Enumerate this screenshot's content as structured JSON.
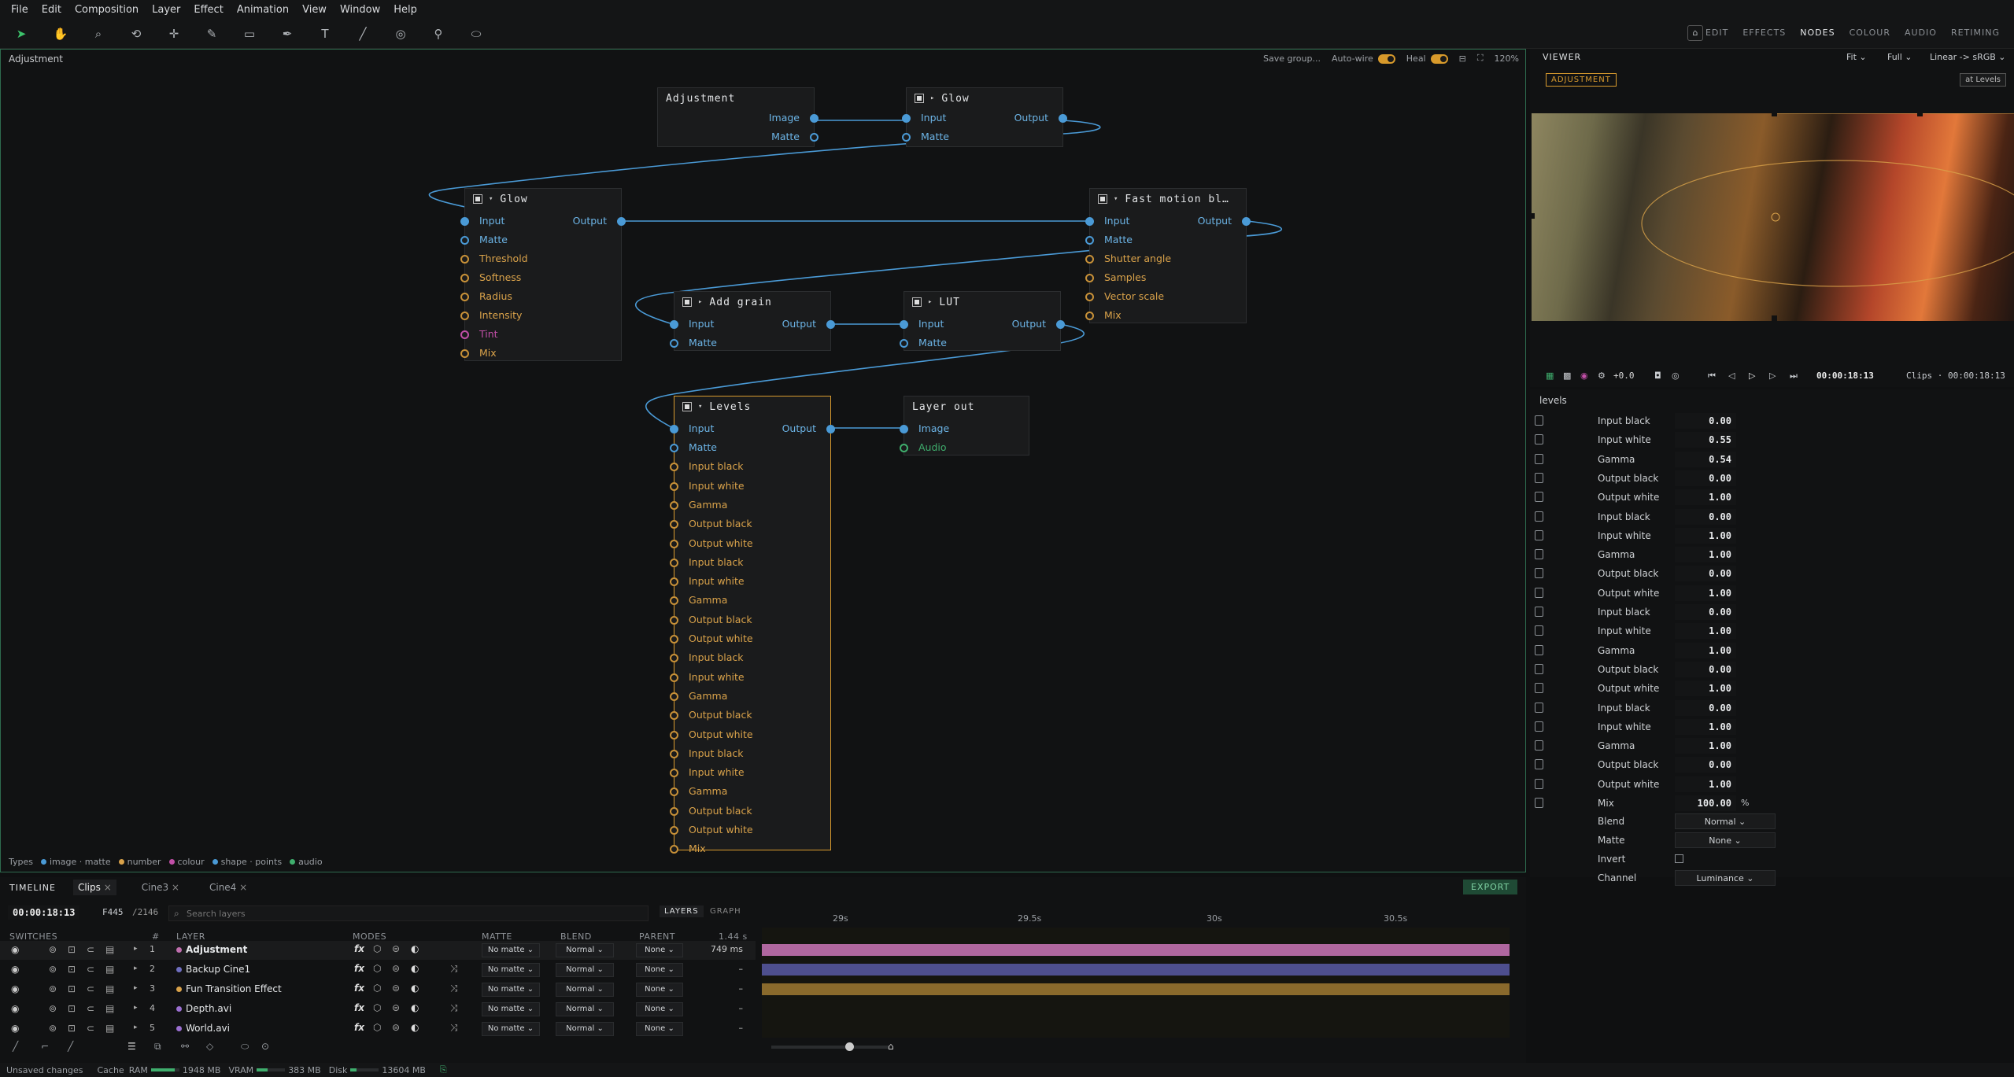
{
  "menu": [
    "File",
    "Edit",
    "Composition",
    "Layer",
    "Effect",
    "Animation",
    "View",
    "Window",
    "Help"
  ],
  "workspace_tabs": [
    "EDIT",
    "EFFECTS",
    "NODES",
    "COLOUR",
    "AUDIO",
    "RETIMING"
  ],
  "workspace_active": "NODES",
  "node_editor": {
    "title": "Adjustment",
    "save_group": "Save group...",
    "auto_wire": "Auto-wire",
    "heal": "Heal",
    "zoom": "120%",
    "types_label": "Types",
    "types": [
      {
        "label": "image · matte",
        "color": "#4a9ad6"
      },
      {
        "label": "number",
        "color": "#d9a24a"
      },
      {
        "label": "colour",
        "color": "#c14fa7"
      },
      {
        "label": "shape · points",
        "color": "#4a9ad6"
      },
      {
        "label": "audio",
        "color": "#3fae6d"
      }
    ]
  },
  "nodes": {
    "adjustment": {
      "title": "Adjustment",
      "outputs": [
        "Image",
        "Matte"
      ]
    },
    "glow_top": {
      "title": "Glow",
      "inputs": [
        "Input",
        "Matte"
      ],
      "output": "Output"
    },
    "glow": {
      "title": "Glow",
      "input": "Input",
      "output": "Output",
      "params": [
        "Matte",
        "Threshold",
        "Softness",
        "Radius",
        "Intensity",
        "Tint",
        "Mix"
      ]
    },
    "fast_motion": {
      "title": "Fast motion bl…",
      "input": "Input",
      "output": "Output",
      "params": [
        "Matte",
        "Shutter angle",
        "Samples",
        "Vector scale",
        "Mix"
      ]
    },
    "add_grain": {
      "title": "Add grain",
      "input": "Input",
      "output": "Output",
      "params": [
        "Matte"
      ]
    },
    "lut": {
      "title": "LUT",
      "input": "Input",
      "output": "Output",
      "params": [
        "Matte"
      ]
    },
    "levels": {
      "title": "Levels",
      "input": "Input",
      "output": "Output",
      "params": [
        "Matte",
        "Input black",
        "Input white",
        "Gamma",
        "Output black",
        "Output white",
        "Input black",
        "Input white",
        "Gamma",
        "Output black",
        "Output white",
        "Input black",
        "Input white",
        "Gamma",
        "Output black",
        "Output white",
        "Input black",
        "Input white",
        "Gamma",
        "Output black",
        "Output white",
        "Mix"
      ]
    },
    "layer_out": {
      "title": "Layer out",
      "inputs": [
        "Image",
        "Audio"
      ]
    }
  },
  "viewer": {
    "title": "VIEWER",
    "fit": "Fit",
    "quality": "Full",
    "colorspace": "Linear -> sRGB",
    "badge": "ADJUSTMENT",
    "at_label": "at Levels",
    "exposure": "+0.0",
    "timecode": "00:00:18:13",
    "clips_tc": "Clips · 00:00:18:13"
  },
  "properties": {
    "section": "levels",
    "rows": [
      {
        "label": "Input black",
        "value": "0.00"
      },
      {
        "label": "Input white",
        "value": "0.55"
      },
      {
        "label": "Gamma",
        "value": "0.54"
      },
      {
        "label": "Output black",
        "value": "0.00"
      },
      {
        "label": "Output white",
        "value": "1.00"
      },
      {
        "label": "Input black",
        "value": "0.00"
      },
      {
        "label": "Input white",
        "value": "1.00"
      },
      {
        "label": "Gamma",
        "value": "1.00"
      },
      {
        "label": "Output black",
        "value": "0.00"
      },
      {
        "label": "Output white",
        "value": "1.00"
      },
      {
        "label": "Input black",
        "value": "0.00"
      },
      {
        "label": "Input white",
        "value": "1.00"
      },
      {
        "label": "Gamma",
        "value": "1.00"
      },
      {
        "label": "Output black",
        "value": "0.00"
      },
      {
        "label": "Output white",
        "value": "1.00"
      },
      {
        "label": "Input black",
        "value": "0.00"
      },
      {
        "label": "Input white",
        "value": "1.00"
      },
      {
        "label": "Gamma",
        "value": "1.00"
      },
      {
        "label": "Output black",
        "value": "0.00"
      },
      {
        "label": "Output white",
        "value": "1.00"
      },
      {
        "label": "Mix",
        "value": "100.00",
        "unit": "%"
      }
    ],
    "blend_label": "Blend",
    "blend": "Normal",
    "matte_label": "Matte",
    "matte": "None",
    "invert_label": "Invert",
    "channel_label": "Channel",
    "channel": "Luminance"
  },
  "timeline": {
    "title": "TIMELINE",
    "tabs": [
      "Clips",
      "Cine3",
      "Cine4"
    ],
    "export": "EXPORT",
    "timecode": "00:00:18:13",
    "frame": "F445",
    "total": "/2146",
    "search_placeholder": "Search layers",
    "view_tabs": [
      "LAYERS",
      "GRAPH"
    ],
    "ruler": [
      "29s",
      "29.5s",
      "30s",
      "30.5s"
    ],
    "headers": {
      "switches": "SWITCHES",
      "num": "#",
      "layer": "LAYER",
      "modes": "MODES",
      "matte": "MATTE",
      "blend": "BLEND",
      "parent": "PARENT",
      "time": "1.44 s"
    },
    "layers": [
      {
        "num": "1",
        "name": "Adjustment",
        "color": "#c06fae",
        "matte": "No matte",
        "blend": "Normal",
        "parent": "None",
        "time": "749 ms",
        "bar": "#b0679f"
      },
      {
        "num": "2",
        "name": "Backup Cine1",
        "color": "#6f6fc0",
        "matte": "No matte",
        "blend": "Normal",
        "parent": "None",
        "time": "–",
        "bar": "#4e4f8e"
      },
      {
        "num": "3",
        "name": "Fun Transition Effect",
        "color": "#d9a24a",
        "matte": "No matte",
        "blend": "Normal",
        "parent": "None",
        "time": "–",
        "bar": "#8a6a2c"
      },
      {
        "num": "4",
        "name": "Depth.avi",
        "color": "#9a6fd0",
        "matte": "No matte",
        "blend": "Normal",
        "parent": "None",
        "time": "–",
        "bar": null
      },
      {
        "num": "5",
        "name": "World.avi",
        "color": "#9a6fd0",
        "matte": "No matte",
        "blend": "Normal",
        "parent": "None",
        "time": "–",
        "bar": null
      }
    ]
  },
  "status": {
    "unsaved": "Unsaved changes",
    "cache": "Cache",
    "ram_label": "RAM",
    "ram": "1948 MB",
    "vram_label": "VRAM",
    "vram": "383 MB",
    "disk_label": "Disk",
    "disk": "13604 MB"
  }
}
